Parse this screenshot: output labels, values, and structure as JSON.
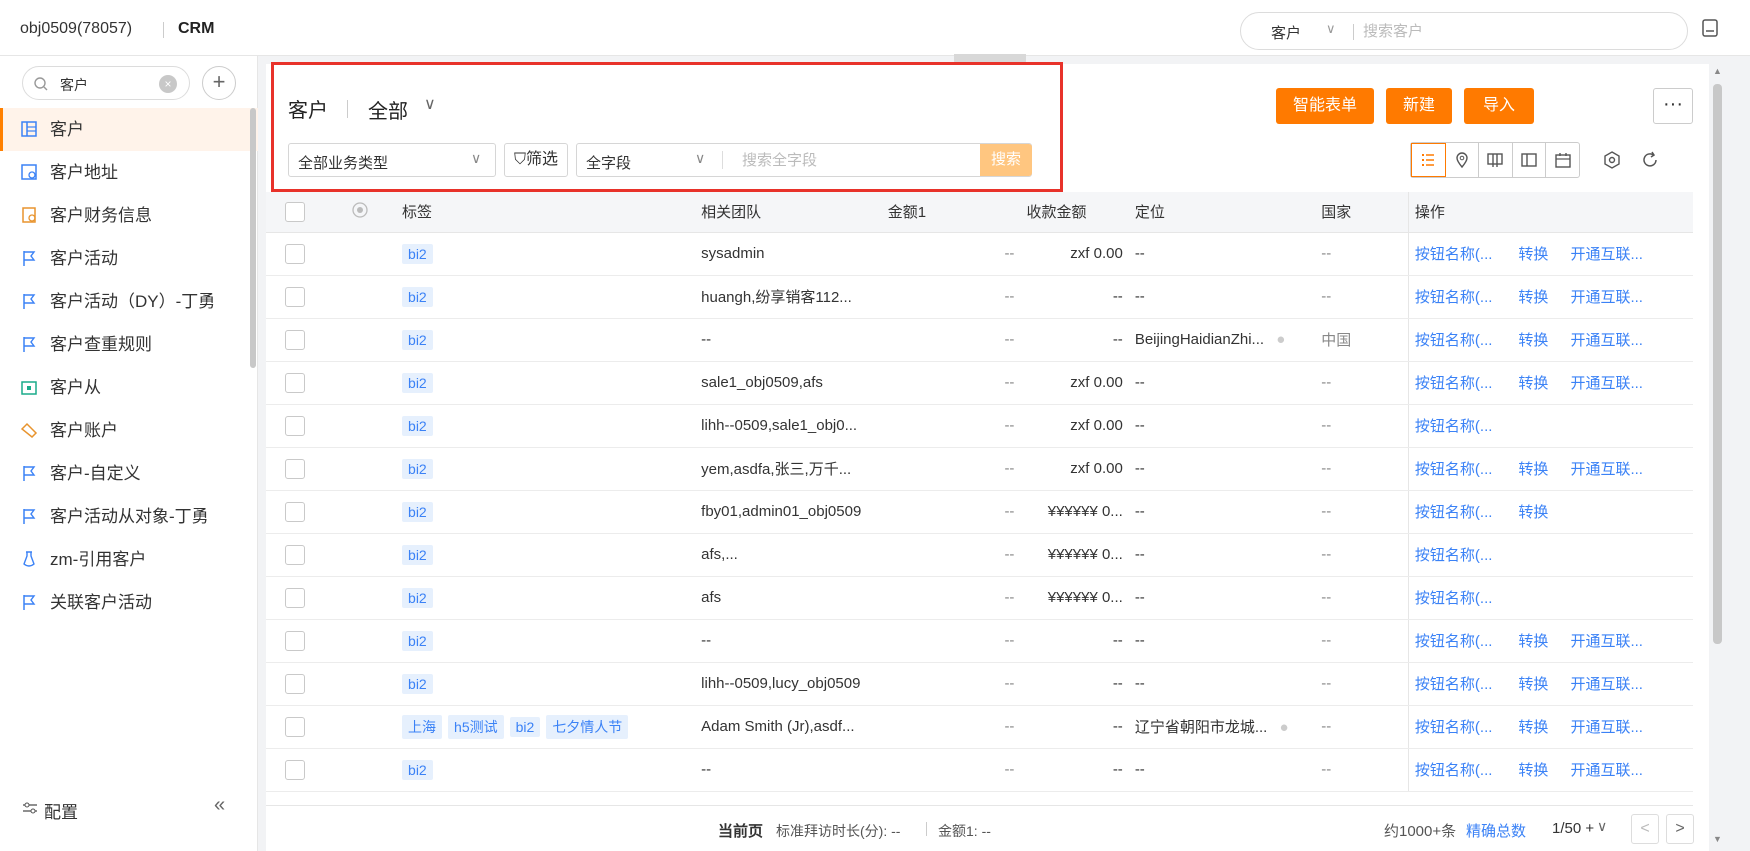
{
  "topbar": {
    "org": "obj0509(78057)",
    "app": "CRM",
    "search_scope": "客户",
    "search_placeholder": "搜索客户"
  },
  "sidebar": {
    "search_value": "客户",
    "items": [
      {
        "label": "客户",
        "icon": "table-icon",
        "active": true
      },
      {
        "label": "客户地址",
        "icon": "address-icon"
      },
      {
        "label": "客户财务信息",
        "icon": "finance-icon"
      },
      {
        "label": "客户活动",
        "icon": "flag-icon"
      },
      {
        "label": "客户活动（DY）-丁勇",
        "icon": "flag-icon"
      },
      {
        "label": "客户查重规则",
        "icon": "flag-icon"
      },
      {
        "label": "客户从",
        "icon": "folder-icon"
      },
      {
        "label": "客户账户",
        "icon": "handshake-icon"
      },
      {
        "label": "客户-自定义",
        "icon": "flag-icon"
      },
      {
        "label": "客户活动从对象-丁勇",
        "icon": "flag-icon"
      },
      {
        "label": "zm-引用客户",
        "icon": "vase-icon"
      },
      {
        "label": "关联客户活动",
        "icon": "flag-icon"
      }
    ],
    "config_label": "配置",
    "collapse_label": "«"
  },
  "header": {
    "title": "客户",
    "view": "全部",
    "business_type": "全部业务类型",
    "filter_label": "筛选",
    "field_select": "全字段",
    "search_placeholder": "搜索全字段",
    "search_button": "搜索",
    "smart_form": "智能表单",
    "new": "新建",
    "import": "导入",
    "more": "···",
    "accent": "#ff7a00"
  },
  "table": {
    "columns": [
      "标签",
      "相关团队",
      "金额1",
      "收款金额",
      "定位",
      "国家",
      "操作"
    ],
    "rows": [
      {
        "tags": [
          "bi2"
        ],
        "team": "sysadmin",
        "amount1": "--",
        "received": "zxf 0.00",
        "location": "--",
        "loc_pin": false,
        "country": "--",
        "actions": [
          "按钮名称(...",
          "转换",
          "开通互联..."
        ]
      },
      {
        "tags": [
          "bi2"
        ],
        "team": "huangh,纷享销客112...",
        "amount1": "--",
        "received": "--",
        "location": "--",
        "loc_pin": false,
        "country": "--",
        "actions": [
          "按钮名称(...",
          "转换",
          "开通互联..."
        ]
      },
      {
        "tags": [
          "bi2"
        ],
        "team": "--",
        "amount1": "--",
        "received": "--",
        "location": "BeijingHaidianZhi...",
        "loc_pin": true,
        "country": "中国",
        "actions": [
          "按钮名称(...",
          "转换",
          "开通互联..."
        ]
      },
      {
        "tags": [
          "bi2"
        ],
        "team": "sale1_obj0509,afs",
        "amount1": "--",
        "received": "zxf 0.00",
        "location": "--",
        "loc_pin": false,
        "country": "--",
        "actions": [
          "按钮名称(...",
          "转换",
          "开通互联..."
        ]
      },
      {
        "tags": [
          "bi2"
        ],
        "team": "lihh--0509,sale1_obj0...",
        "amount1": "--",
        "received": "zxf 0.00",
        "location": "--",
        "loc_pin": false,
        "country": "--",
        "actions": [
          "按钮名称(..."
        ]
      },
      {
        "tags": [
          "bi2"
        ],
        "team": "yem,asdfa,张三,万千...",
        "amount1": "--",
        "received": "zxf 0.00",
        "location": "--",
        "loc_pin": false,
        "country": "--",
        "actions": [
          "按钮名称(...",
          "转换",
          "开通互联..."
        ]
      },
      {
        "tags": [
          "bi2"
        ],
        "team": "fby01,admin01_obj0509",
        "amount1": "--",
        "received": "¥¥¥¥¥¥ 0...",
        "location": "--",
        "loc_pin": false,
        "country": "--",
        "actions": [
          "按钮名称(...",
          "转换"
        ]
      },
      {
        "tags": [
          "bi2"
        ],
        "team": "afs,...",
        "amount1": "--",
        "received": "¥¥¥¥¥¥ 0...",
        "location": "--",
        "loc_pin": false,
        "country": "--",
        "actions": [
          "按钮名称(..."
        ]
      },
      {
        "tags": [
          "bi2"
        ],
        "team": "afs",
        "amount1": "--",
        "received": "¥¥¥¥¥¥ 0...",
        "location": "--",
        "loc_pin": false,
        "country": "--",
        "actions": [
          "按钮名称(..."
        ]
      },
      {
        "tags": [
          "bi2"
        ],
        "team": "--",
        "amount1": "--",
        "received": "--",
        "location": "--",
        "loc_pin": false,
        "country": "--",
        "actions": [
          "按钮名称(...",
          "转换",
          "开通互联..."
        ]
      },
      {
        "tags": [
          "bi2"
        ],
        "team": "lihh--0509,lucy_obj0509",
        "amount1": "--",
        "received": "--",
        "location": "--",
        "loc_pin": false,
        "country": "--",
        "actions": [
          "按钮名称(...",
          "转换",
          "开通互联..."
        ]
      },
      {
        "tags": [
          "上海",
          "h5测试",
          "bi2",
          "七夕情人节"
        ],
        "team": "Adam Smith (Jr),asdf...",
        "amount1": "--",
        "received": "--",
        "location": "辽宁省朝阳市龙城...",
        "loc_pin": true,
        "country": "--",
        "actions": [
          "按钮名称(...",
          "转换",
          "开通互联..."
        ]
      },
      {
        "tags": [
          "bi2"
        ],
        "team": "--",
        "amount1": "--",
        "received": "--",
        "location": "--",
        "loc_pin": false,
        "country": "--",
        "actions": [
          "按钮名称(...",
          "转换",
          "开通互联..."
        ]
      }
    ]
  },
  "footer": {
    "current_page": "当前页",
    "visit_duration": "标准拜访时长(分): --",
    "amount1": "金额1: --",
    "count": "约1000+条",
    "exact": "精确总数",
    "page": "1/50 +",
    "prev": "<",
    "next": ">"
  }
}
